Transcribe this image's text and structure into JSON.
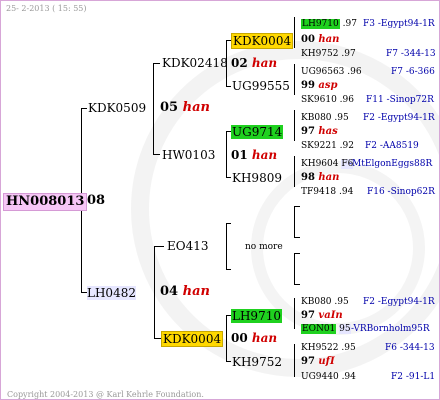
{
  "header": {
    "date": "25- 2-2013 ( 15: 55)"
  },
  "footer": {
    "copyright": "Copyright 2004-2013 @ Karl Kehrle Foundation."
  },
  "root": {
    "ring": "HN008013",
    "gen": "08"
  },
  "father": {
    "ring": "KDK0509",
    "gen": "05",
    "gen_note": "han"
  },
  "mother": {
    "ring": "LH0482",
    "gen": "04",
    "gen_note": "han"
  },
  "ff": {
    "ring": "KDK02418",
    "gen": "02",
    "gen_note": "han"
  },
  "fm": {
    "ring": "HW0103",
    "gen": "01",
    "gen_note": "han"
  },
  "mf": {
    "ring": "EO413",
    "gen": "no more"
  },
  "mm": {
    "ring": "KDK0004",
    "gen": "00",
    "gen_note": "han"
  },
  "fff": {
    "ring": "KDK0004",
    "gen": "00",
    "gen_note": "han"
  },
  "ffm": {
    "ring": "UG99555"
  },
  "fmf": {
    "ring": "UG9714",
    "gen": "97",
    "gen_note": "has"
  },
  "fmm": {
    "ring": "KH9809",
    "gen": "98",
    "gen_note": "han"
  },
  "mmf": {
    "ring": "LH9710",
    "gen": "97",
    "gen_note": "vaIn"
  },
  "mmm": {
    "ring": "KH9752",
    "gen": "97",
    "gen_note": "ufI"
  },
  "ffff": {
    "ring": "LH9710",
    "year": ".97",
    "place": "F3 -Egypt94-1R"
  },
  "fffm": {
    "ring": "KH9752",
    "year": ".97",
    "place": "F7 -344-13"
  },
  "ffmf": {
    "ring": "UG96563",
    "year": ".96",
    "place": "F7 -6-366"
  },
  "ffm_gen": {
    "gen": "99",
    "gen_note": "asp"
  },
  "ffmm": {
    "ring": "SK9610",
    "year": ".96",
    "place": "F11 -Sinop72R"
  },
  "fmff": {
    "ring": "KB080",
    "year": ".95",
    "place": "F2 -Egypt94-1R"
  },
  "fmfm": {
    "ring": "SK9221",
    "year": ".92",
    "place": "F2 -AA8519"
  },
  "fmmf": {
    "ring": "KH9604",
    "year": "F6",
    "place": "-MtElgonEggs88R"
  },
  "fmmm": {
    "ring": "TF9418",
    "year": ".94",
    "place": "F16 -Sinop62R"
  },
  "mmff": {
    "ring": "KB080",
    "year": ".95",
    "place": "F2 -Egypt94-1R"
  },
  "mmfm": {
    "ring": "EON01",
    "year": "95",
    "place": "-VRBornholm95R"
  },
  "mmmf": {
    "ring": "KH9522",
    "year": ".95",
    "place": "F6 -344-13"
  },
  "mmmm": {
    "ring": "UG9440",
    "year": ".94",
    "place": "F2 -91-L1"
  }
}
